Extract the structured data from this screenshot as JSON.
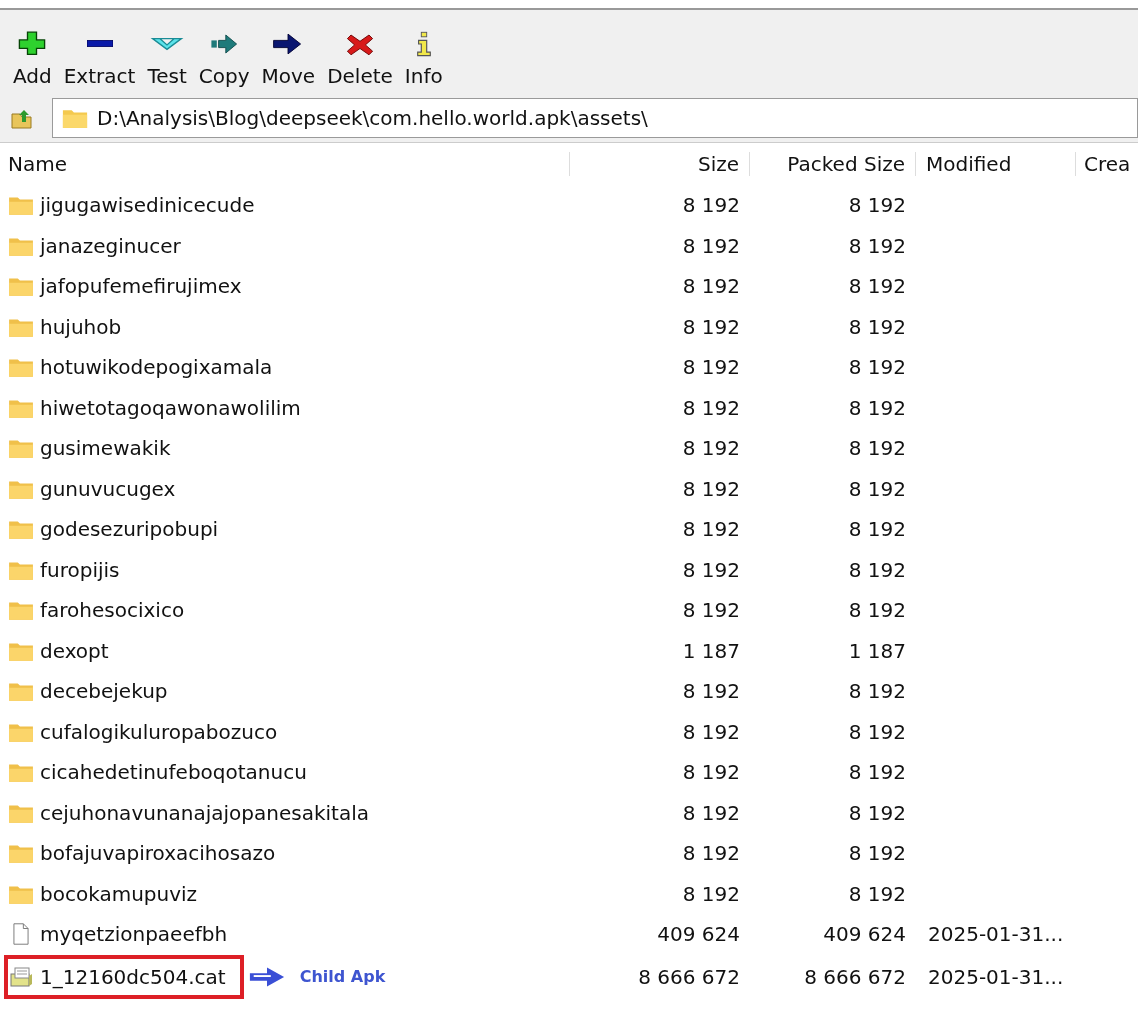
{
  "toolbar": [
    {
      "label": "Add"
    },
    {
      "label": "Extract"
    },
    {
      "label": "Test"
    },
    {
      "label": "Copy"
    },
    {
      "label": "Move"
    },
    {
      "label": "Delete"
    },
    {
      "label": "Info"
    }
  ],
  "address_bar": {
    "value": "D:\\Analysis\\Blog\\deepseek\\com.hello.world.apk\\assets\\"
  },
  "table": {
    "columns": [
      "Name",
      "Size",
      "Packed Size",
      "Modified",
      "Crea"
    ],
    "rows": [
      {
        "kind": "folder",
        "name": "jigugawisedinicecude",
        "size": "8 192",
        "packed_size": "8 192",
        "highlighted": false
      },
      {
        "kind": "folder",
        "name": "janazeginucer",
        "size": "8 192",
        "packed_size": "8 192",
        "highlighted": false
      },
      {
        "kind": "folder",
        "name": "jafopufemefirujimex",
        "size": "8 192",
        "packed_size": "8 192",
        "highlighted": false
      },
      {
        "kind": "folder",
        "name": "hujuhob",
        "size": "8 192",
        "packed_size": "8 192",
        "highlighted": false
      },
      {
        "kind": "folder",
        "name": "hotuwikodepogixamala",
        "size": "8 192",
        "packed_size": "8 192",
        "highlighted": false
      },
      {
        "kind": "folder",
        "name": "hiwetotagoqawonawolilim",
        "size": "8 192",
        "packed_size": "8 192",
        "highlighted": false
      },
      {
        "kind": "folder",
        "name": "gusimewakik",
        "size": "8 192",
        "packed_size": "8 192",
        "highlighted": false
      },
      {
        "kind": "folder",
        "name": "gunuvucugex",
        "size": "8 192",
        "packed_size": "8 192",
        "highlighted": false
      },
      {
        "kind": "folder",
        "name": "godesezuripobupi",
        "size": "8 192",
        "packed_size": "8 192",
        "highlighted": false
      },
      {
        "kind": "folder",
        "name": "furopijis",
        "size": "8 192",
        "packed_size": "8 192",
        "highlighted": false
      },
      {
        "kind": "folder",
        "name": "farohesocixico",
        "size": "8 192",
        "packed_size": "8 192",
        "highlighted": false
      },
      {
        "kind": "folder",
        "name": "dexopt",
        "size": "1 187",
        "packed_size": "1 187",
        "highlighted": false
      },
      {
        "kind": "folder",
        "name": "decebejekup",
        "size": "8 192",
        "packed_size": "8 192",
        "highlighted": false
      },
      {
        "kind": "folder",
        "name": "cufalogikuluropabozuco",
        "size": "8 192",
        "packed_size": "8 192",
        "highlighted": false
      },
      {
        "kind": "folder",
        "name": "cicahedetinufeboqotanucu",
        "size": "8 192",
        "packed_size": "8 192",
        "highlighted": false
      },
      {
        "kind": "folder",
        "name": "cejuhonavunanajajopanesakitala",
        "size": "8 192",
        "packed_size": "8 192",
        "highlighted": false
      },
      {
        "kind": "folder",
        "name": "bofajuvapiroxacihosazo",
        "size": "8 192",
        "packed_size": "8 192",
        "highlighted": false
      },
      {
        "kind": "folder",
        "name": "bocokamupuviz",
        "size": "8 192",
        "packed_size": "8 192",
        "highlighted": false
      },
      {
        "kind": "file",
        "name": "myqetzionpaeefbh",
        "size": "409 624",
        "packed_size": "409 624",
        "modified": "2025-01-31...",
        "highlighted": false
      },
      {
        "kind": "archive",
        "name": "1_12160dc504.cat",
        "size": "8 666 672",
        "packed_size": "8 666 672",
        "modified": "2025-01-31...",
        "highlighted": true,
        "annotation": "Child Apk"
      }
    ]
  }
}
